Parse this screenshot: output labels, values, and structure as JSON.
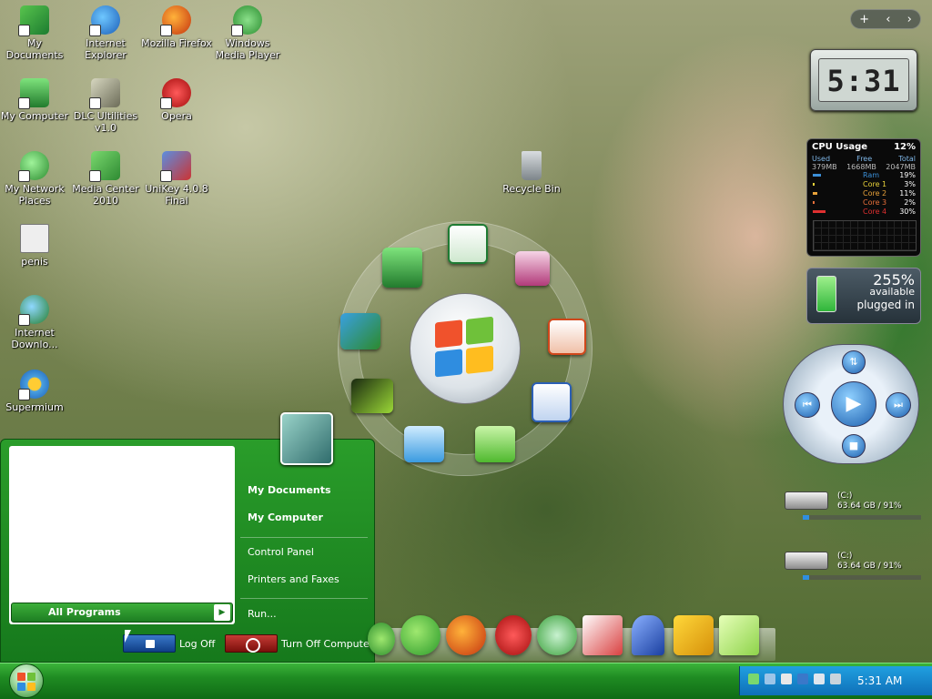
{
  "desktop_icons": [
    {
      "label": "My Documents",
      "icon": "my-documents-icon"
    },
    {
      "label": "Internet Explorer",
      "icon": "internet-explorer-icon"
    },
    {
      "label": "Mozilla Firefox",
      "icon": "firefox-icon"
    },
    {
      "label": "Windows Media Player",
      "icon": "windows-media-player-icon"
    },
    {
      "label": "My Computer",
      "icon": "my-computer-icon"
    },
    {
      "label": "DLC Ultilities v1.0",
      "icon": "dlc-utilities-icon"
    },
    {
      "label": "Opera",
      "icon": "opera-icon"
    },
    {
      "label": "My Network Places",
      "icon": "network-places-icon"
    },
    {
      "label": "Media Center 2010",
      "icon": "media-center-icon"
    },
    {
      "label": "UniKey 4.0.8 Final",
      "icon": "unikey-icon"
    },
    {
      "label": "penis",
      "icon": "file-icon"
    },
    {
      "label": "Internet Downlo...",
      "icon": "internet-download-icon"
    },
    {
      "label": "Supermium",
      "icon": "supermium-icon"
    },
    {
      "label": "Recycle Bin",
      "icon": "recycle-bin-icon"
    }
  ],
  "gadget_controls": {
    "add": "+",
    "prev": "‹",
    "next": "›"
  },
  "clock_gadget": {
    "time": "5:31"
  },
  "cpu_gadget": {
    "title": "CPU Usage",
    "total_percent": "12%",
    "mem_headers": [
      "Used",
      "Free",
      "Total"
    ],
    "mem_values": [
      "379MB",
      "1668MB",
      "2047MB"
    ],
    "rows": [
      {
        "label": "Ram",
        "value": "19%",
        "color": "#3b8fd8",
        "level": 0.19
      },
      {
        "label": "Core 1",
        "value": "3%",
        "color": "#e8d23a",
        "level": 0.03
      },
      {
        "label": "Core 2",
        "value": "11%",
        "color": "#e8a23a",
        "level": 0.11
      },
      {
        "label": "Core 3",
        "value": "2%",
        "color": "#e8703a",
        "level": 0.02
      },
      {
        "label": "Core 4",
        "value": "30%",
        "color": "#e03030",
        "level": 0.3
      }
    ]
  },
  "battery_gadget": {
    "percent": "255%",
    "available": "available",
    "status": "plugged in"
  },
  "drives": [
    {
      "name": "(C:)",
      "info": "63.64 GB / 91%",
      "level": 0.05
    },
    {
      "name": "(C:)",
      "info": "63.64 GB / 91%",
      "level": 0.05
    }
  ],
  "orb_menu": {
    "items": [
      "my-computer-icon",
      "excel-icon",
      "access-icon",
      "powerpoint-icon",
      "word-icon",
      "drive-green-icon",
      "drive-blue-icon",
      "wallpaper-icon",
      "contacts-icon"
    ]
  },
  "start_menu": {
    "all_programs": "All Programs",
    "right_items": [
      "My Documents",
      "My Computer",
      "Control Panel",
      "Printers and Faxes",
      "Run..."
    ],
    "log_off": "Log Off",
    "turn_off": "Turn Off Computer"
  },
  "dock": {
    "items": [
      "leaf-icon",
      "internet-explorer-icon",
      "firefox-icon",
      "opera-icon",
      "skype-icon",
      "acrobat-icon",
      "feather-icon",
      "tools-icon",
      "folder-icon"
    ]
  },
  "taskbar": {
    "clock": "5:31 AM"
  },
  "colors": {
    "taskbar_green": "#1f8b22",
    "start_menu_green": "#2a9d2a",
    "tray_blue": "#0f6fb8"
  }
}
